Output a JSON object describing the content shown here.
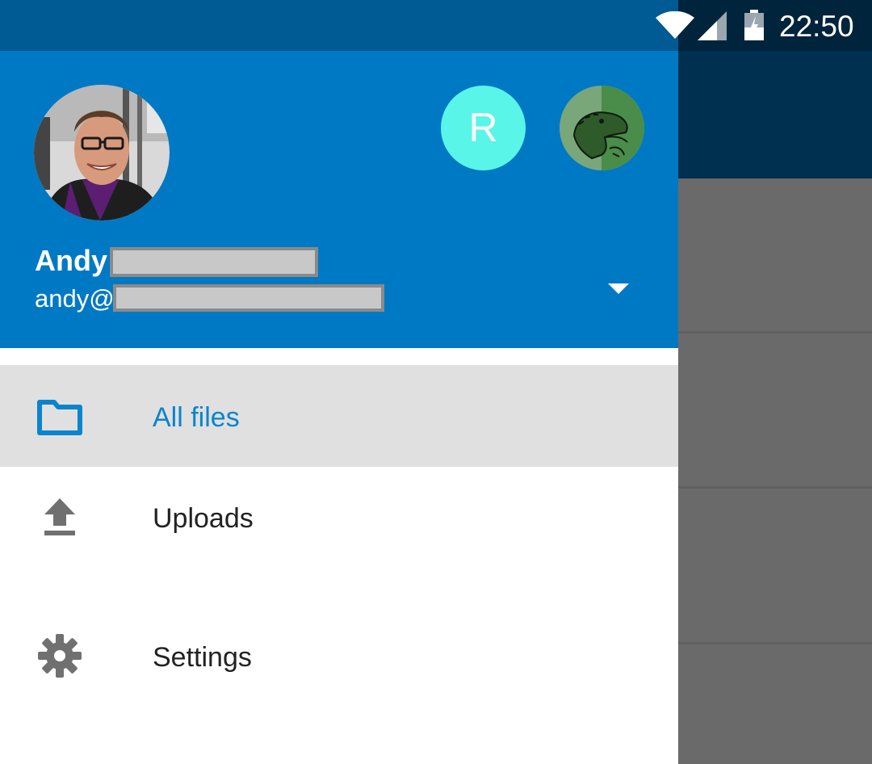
{
  "status_bar": {
    "time": "22:50"
  },
  "account": {
    "name": "Andy",
    "email": "andy@",
    "secondary_account_initial": "R"
  },
  "menu": [
    {
      "label": "All files",
      "icon": "folder-icon",
      "selected": true
    },
    {
      "label": "Uploads",
      "icon": "upload-icon",
      "selected": false
    },
    {
      "label": "Settings",
      "icon": "gear-icon",
      "selected": false
    }
  ],
  "colors": {
    "header": "#0079c4",
    "status_bar": "#005a94",
    "accent": "#0a84cd",
    "selected_row": "#e0e0e0",
    "secondary_avatar": "#59f5e8"
  }
}
